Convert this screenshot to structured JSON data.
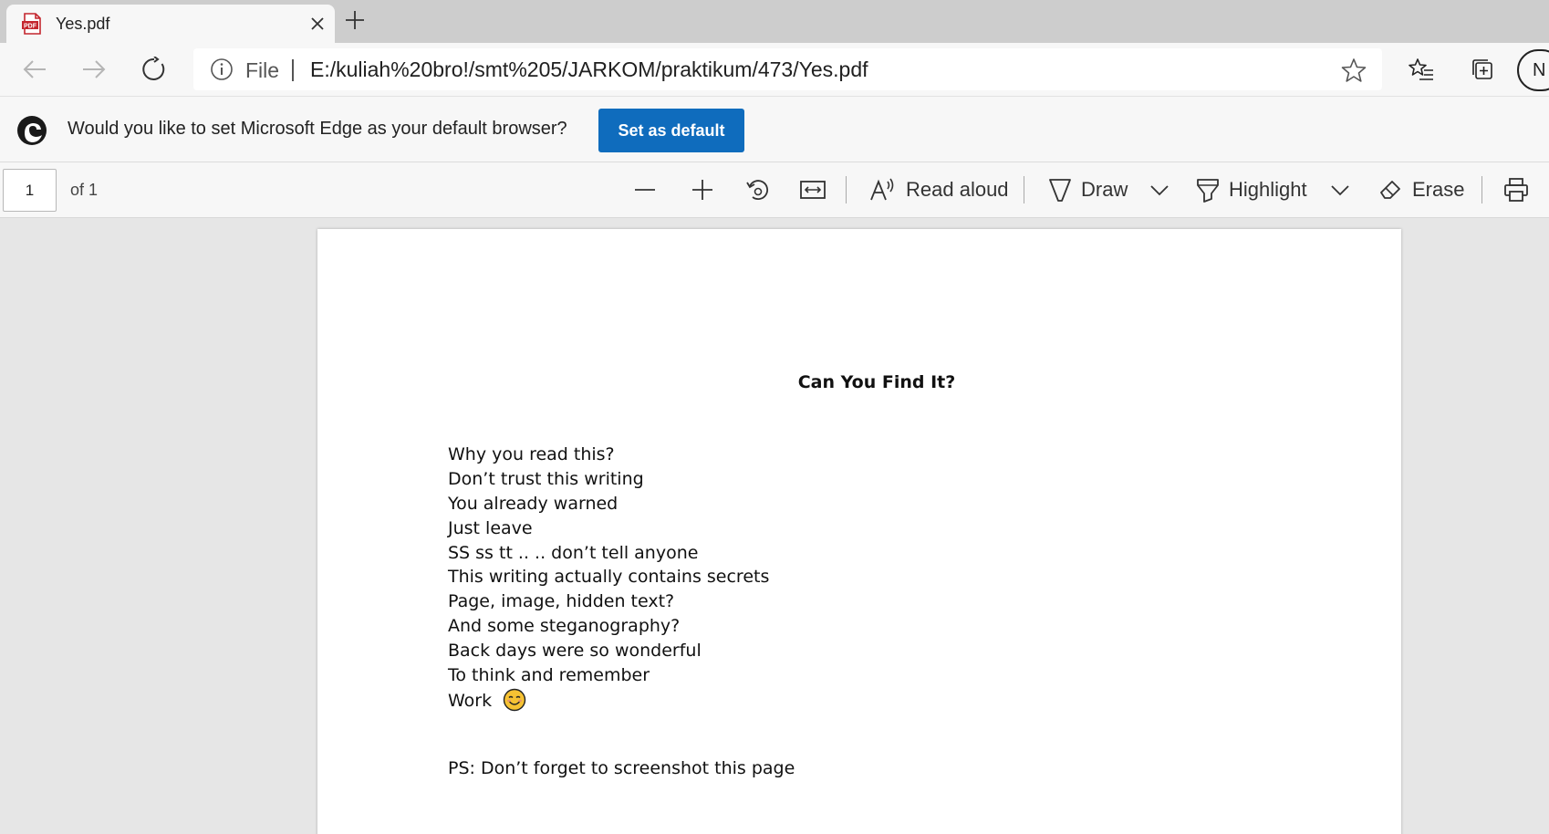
{
  "tab": {
    "title": "Yes.pdf",
    "favicon": "pdf-file-icon",
    "favicon_text": "PDF"
  },
  "address_bar": {
    "scheme_label": "File",
    "url": "E:/kuliah%20bro!/smt%205/JARKOM/praktikum/473/Yes.pdf"
  },
  "profile": {
    "initial": "N"
  },
  "infobar": {
    "message": "Would you like to set Microsoft Edge as your default browser?",
    "button_label": "Set as default"
  },
  "pdf_toolbar": {
    "page_number": "1",
    "page_total_label": "of 1",
    "read_aloud_label": "Read aloud",
    "draw_label": "Draw",
    "highlight_label": "Highlight",
    "erase_label": "Erase"
  },
  "document": {
    "title": "Can You Find It?",
    "lines": [
      "Why you read this?",
      "Don’t trust this writing",
      "You already warned",
      "Just leave",
      "SS ss tt .. .. don’t tell anyone",
      "This writing actually contains secrets",
      "Page, image, hidden text?",
      "And some steganography?",
      "Back days were so wonderful",
      "To think and remember",
      "Work"
    ],
    "emoji": "smiling-face-emoji",
    "postscript": "PS: Don’t forget to screenshot this page"
  },
  "colors": {
    "accent": "#0f6cbd",
    "tabstrip": "#cdcdcd",
    "toolbar": "#f7f7f7",
    "viewer_bg": "#e6e6e6"
  }
}
